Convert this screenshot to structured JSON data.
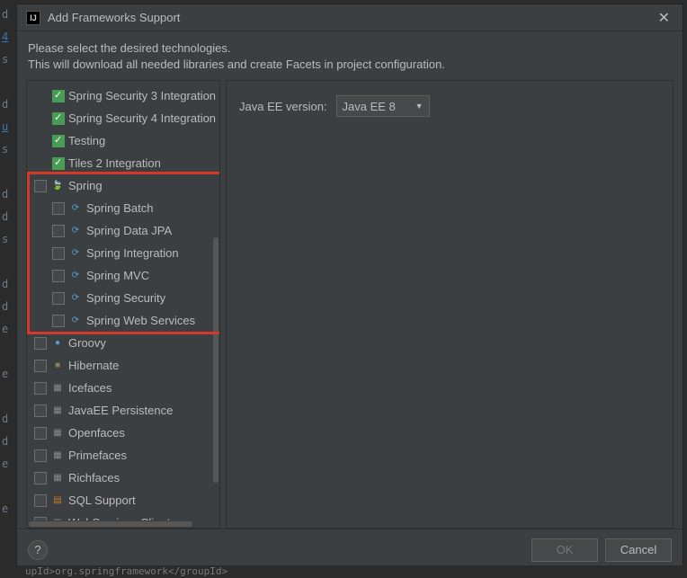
{
  "title": "Add Frameworks Support",
  "intro_line1": "Please select the desired technologies.",
  "intro_line2": "This will download all needed libraries and create Facets in project configuration.",
  "tree": [
    {
      "label": "Spring Security 3 Integration",
      "checked": true,
      "indent": "child",
      "icon": "on-green"
    },
    {
      "label": "Spring Security 4 Integration",
      "checked": true,
      "indent": "child",
      "icon": "on-green"
    },
    {
      "label": "Testing",
      "checked": true,
      "indent": "child",
      "icon": "on-green"
    },
    {
      "label": "Tiles 2 Integration",
      "checked": true,
      "indent": "child",
      "icon": "on-green"
    },
    {
      "label": "Spring",
      "checked": false,
      "indent": "root",
      "icon": "leaf"
    },
    {
      "label": "Spring Batch",
      "checked": false,
      "indent": "child",
      "icon": "sub"
    },
    {
      "label": "Spring Data JPA",
      "checked": false,
      "indent": "child",
      "icon": "sub"
    },
    {
      "label": "Spring Integration",
      "checked": false,
      "indent": "child",
      "icon": "sub"
    },
    {
      "label": "Spring MVC",
      "checked": false,
      "indent": "child",
      "icon": "sub"
    },
    {
      "label": "Spring Security",
      "checked": false,
      "indent": "child",
      "icon": "sub"
    },
    {
      "label": "Spring Web Services",
      "checked": false,
      "indent": "child",
      "icon": "sub"
    },
    {
      "label": "Groovy",
      "checked": false,
      "indent": "root",
      "icon": "groovy"
    },
    {
      "label": "Hibernate",
      "checked": false,
      "indent": "root",
      "icon": "hib"
    },
    {
      "label": "Icefaces",
      "checked": false,
      "indent": "root",
      "icon": "web"
    },
    {
      "label": "JavaEE Persistence",
      "checked": false,
      "indent": "root",
      "icon": "web"
    },
    {
      "label": "Openfaces",
      "checked": false,
      "indent": "root",
      "icon": "web"
    },
    {
      "label": "Primefaces",
      "checked": false,
      "indent": "root",
      "icon": "web"
    },
    {
      "label": "Richfaces",
      "checked": false,
      "indent": "root",
      "icon": "web"
    },
    {
      "label": "SQL Support",
      "checked": false,
      "indent": "root",
      "icon": "sql"
    },
    {
      "label": "WebServices Client",
      "checked": false,
      "indent": "root",
      "icon": "web"
    }
  ],
  "right": {
    "java_ee_label": "Java EE version:",
    "java_ee_value": "Java EE 8"
  },
  "buttons": {
    "help": "?",
    "ok": "OK",
    "cancel": "Cancel"
  },
  "highlight": {
    "top_index": 4,
    "bottom_index": 10
  },
  "background_code": "upId>org.springframework</groupId>"
}
